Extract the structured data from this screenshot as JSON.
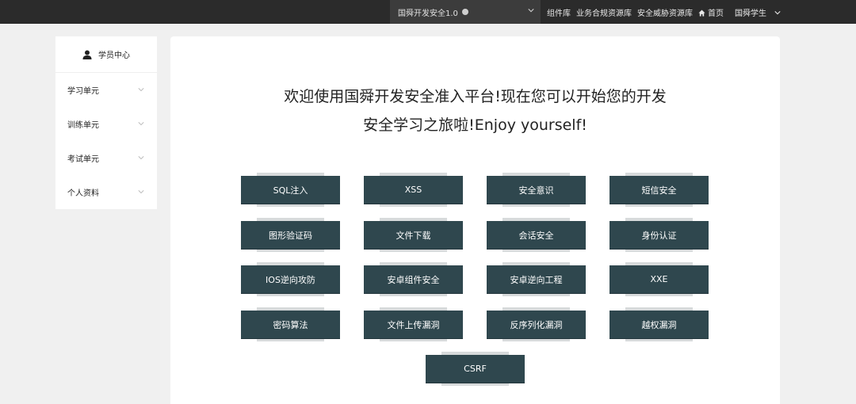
{
  "topbar": {
    "platform_select": "国舜开发安全1.0",
    "links": [
      "组件库",
      "业务合规资源库",
      "安全威胁资源库"
    ],
    "home": "首页",
    "user": "国舜学生"
  },
  "sidebar": {
    "header": "学员中心",
    "items": [
      {
        "label": "学习单元"
      },
      {
        "label": "训练单元"
      },
      {
        "label": "考试单元"
      },
      {
        "label": "个人资料"
      }
    ]
  },
  "main": {
    "welcome_line1": "欢迎使用国舜开发安全准入平台!现在您可以开始您的开发",
    "welcome_line2": "安全学习之旅啦!Enjoy yourself!",
    "modules": [
      "SQL注入",
      "XSS",
      "安全意识",
      "短信安全",
      "图形验证码",
      "文件下载",
      "会话安全",
      "身份认证",
      "IOS逆向攻防",
      "安卓组件安全",
      "安卓逆向工程",
      "XXE",
      "密码算法",
      "文件上传漏洞",
      "反序列化漏洞",
      "越权漏洞",
      "CSRF"
    ]
  },
  "colors": {
    "topbar": "#2b2b2b",
    "button": "#2f474e"
  }
}
